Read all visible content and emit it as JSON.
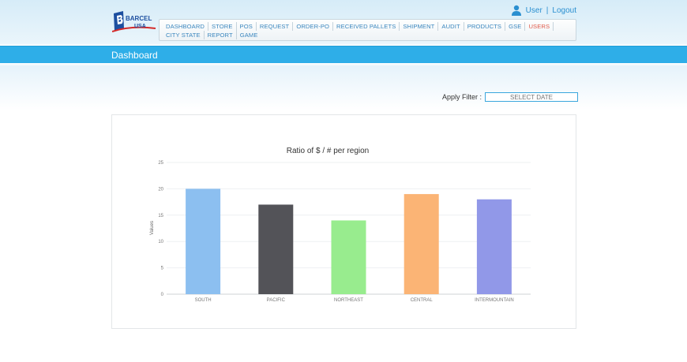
{
  "brand": {
    "name_line1": "BARCEL",
    "name_line2": "USA"
  },
  "user": {
    "user_label": "User",
    "separator": "|",
    "logout_label": "Logout"
  },
  "nav": {
    "items": [
      {
        "label": "DASHBOARD",
        "active": false
      },
      {
        "label": "STORE",
        "active": false
      },
      {
        "label": "POS",
        "active": false
      },
      {
        "label": "REQUEST",
        "active": false
      },
      {
        "label": "ORDER-PO",
        "active": false
      },
      {
        "label": "RECEIVED PALLETS",
        "active": false
      },
      {
        "label": "SHIPMENT",
        "active": false
      },
      {
        "label": "AUDIT",
        "active": false
      },
      {
        "label": "PRODUCTS",
        "active": false
      },
      {
        "label": "GSE",
        "active": false
      },
      {
        "label": "USERS",
        "active": true
      },
      {
        "label": "CITY STATE",
        "active": false
      },
      {
        "label": "REPORT",
        "active": false
      },
      {
        "label": "GAME",
        "active": false
      }
    ]
  },
  "page": {
    "title": "Dashboard"
  },
  "filter": {
    "label": "Apply Filter :",
    "date_placeholder": "SELECT DATE"
  },
  "colors": {
    "accent": "#2eaee8",
    "nav_link": "#3a86be",
    "nav_active": "#e05a4a"
  },
  "chart_data": {
    "type": "bar",
    "title": "Ratio of $ / # per region",
    "xlabel": "",
    "ylabel": "Values",
    "ylim": [
      0,
      25
    ],
    "yticks": [
      0,
      5,
      10,
      15,
      20,
      25
    ],
    "grid": true,
    "categories": [
      "SOUTH",
      "PACIFIC",
      "NORTHEAST",
      "CENTRAL",
      "INTERMOUNTAIN"
    ],
    "values": [
      20,
      17,
      14,
      19,
      18
    ],
    "bar_colors": [
      "#8cbff0",
      "#535358",
      "#98ec8e",
      "#fbb475",
      "#9198e8"
    ]
  }
}
